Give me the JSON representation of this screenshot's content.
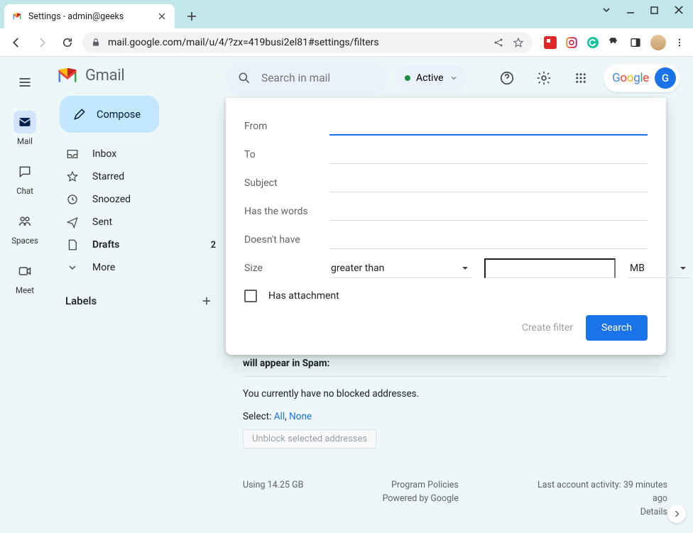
{
  "browser": {
    "tab_title": "Settings - admin@geeks",
    "url": "mail.google.com/mail/u/4/?zx=419busi2el81#settings/filters"
  },
  "rail": {
    "items": [
      {
        "label": "Mail"
      },
      {
        "label": "Chat"
      },
      {
        "label": "Spaces"
      },
      {
        "label": "Meet"
      }
    ]
  },
  "brand": "Gmail",
  "compose": "Compose",
  "nav": {
    "inbox": "Inbox",
    "starred": "Starred",
    "snoozed": "Snoozed",
    "sent": "Sent",
    "drafts": "Drafts",
    "drafts_count": "2",
    "more": "More",
    "labels": "Labels"
  },
  "search": {
    "placeholder": "Search in mail"
  },
  "status": "Active",
  "google_chip": "Google",
  "avatar_letter": "G",
  "panel": {
    "from": "From",
    "to": "To",
    "subject": "Subject",
    "has_words": "Has the words",
    "doesnt_have": "Doesn't have",
    "size": "Size",
    "size_op": "greater than",
    "size_unit": "MB",
    "has_attachment": "Has attachment",
    "create_filter": "Create filter",
    "search_btn": "Search"
  },
  "settings": {
    "spam_line": "will appear in Spam:",
    "no_blocked": "You currently have no blocked addresses.",
    "select": "Select:",
    "all": "All",
    "none": "None",
    "unblock": "Unblock selected addresses",
    "storage": "Using 14.25 GB",
    "policies": "Program Policies",
    "powered": "Powered by Google",
    "activity1": "Last account activity: 39 minutes",
    "activity2": "ago",
    "details": "Details"
  }
}
